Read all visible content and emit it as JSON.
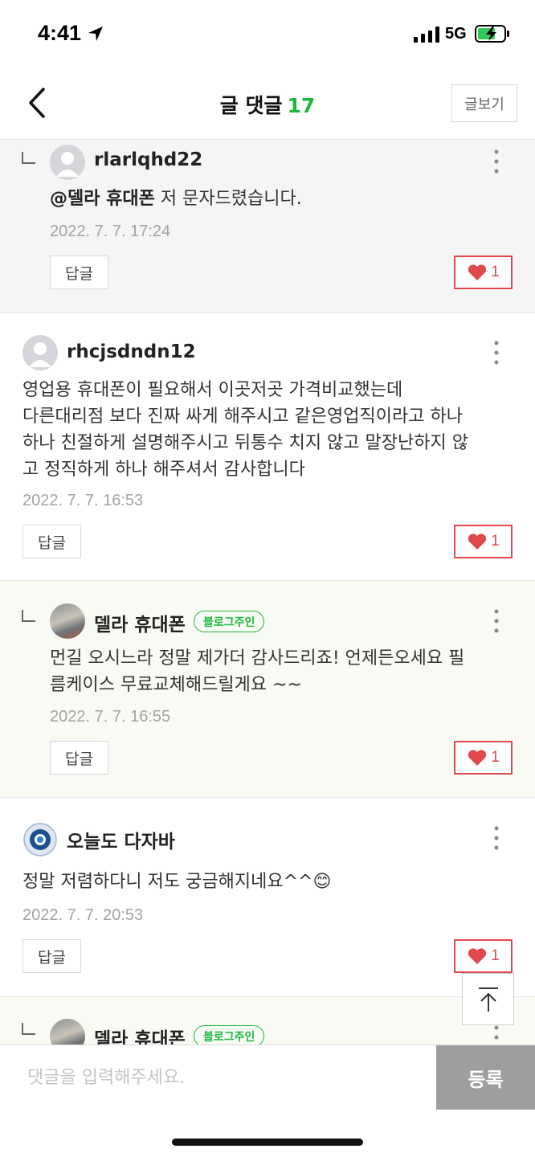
{
  "status_bar": {
    "time": "4:41",
    "network": "5G"
  },
  "header": {
    "title": "글 댓글",
    "count": "17",
    "view_post_label": "글보기"
  },
  "comments": [
    {
      "author": "rlarlqhd22",
      "mention": "@델라 휴대폰",
      "text": " 저 문자드렸습니다.",
      "date": "2022. 7. 7. 17:24",
      "reply_label": "답글",
      "likes": "1"
    },
    {
      "author": "rhcjsdndn12",
      "lines": [
        "영업용 휴대폰이 필요해서 이곳저곳 가격비교했는데",
        "다른대리점 보다 진짜 싸게 해주시고 같은영업직이라고 하나",
        "하나 친절하게 설명해주시고 뒤통수 치지 않고 말장난하지 않",
        "고 정직하게 하나 해주셔서 감사합니다"
      ],
      "date": "2022. 7. 7. 16:53",
      "reply_label": "답글",
      "likes": "1"
    },
    {
      "author": "델라 휴대폰",
      "badge": "블로그주인",
      "lines": [
        "먼길 오시느라 정말 제가더 감사드리죠! 언제든오세요 필",
        "름케이스 무료교체해드릴게요 ~~"
      ],
      "date": "2022. 7. 7. 16:55",
      "reply_label": "답글",
      "likes": "1"
    },
    {
      "author": "오늘도 다자바",
      "text": "정말 저렴하다니 저도 궁금해지네요^^😊",
      "date": "2022. 7. 7. 20:53",
      "reply_label": "답글",
      "likes": "1"
    },
    {
      "author": "델라 휴대폰",
      "badge": "블로그주인"
    }
  ],
  "input": {
    "placeholder": "댓글을 입력해주세요.",
    "submit_label": "등록"
  },
  "colors": {
    "accent_green": "#1fb73e",
    "like_red": "#e0484e",
    "reply_bg": "#f5f5f5",
    "owner_reply_bg": "#f8faf4",
    "submit_bg": "#9e9e9e"
  }
}
